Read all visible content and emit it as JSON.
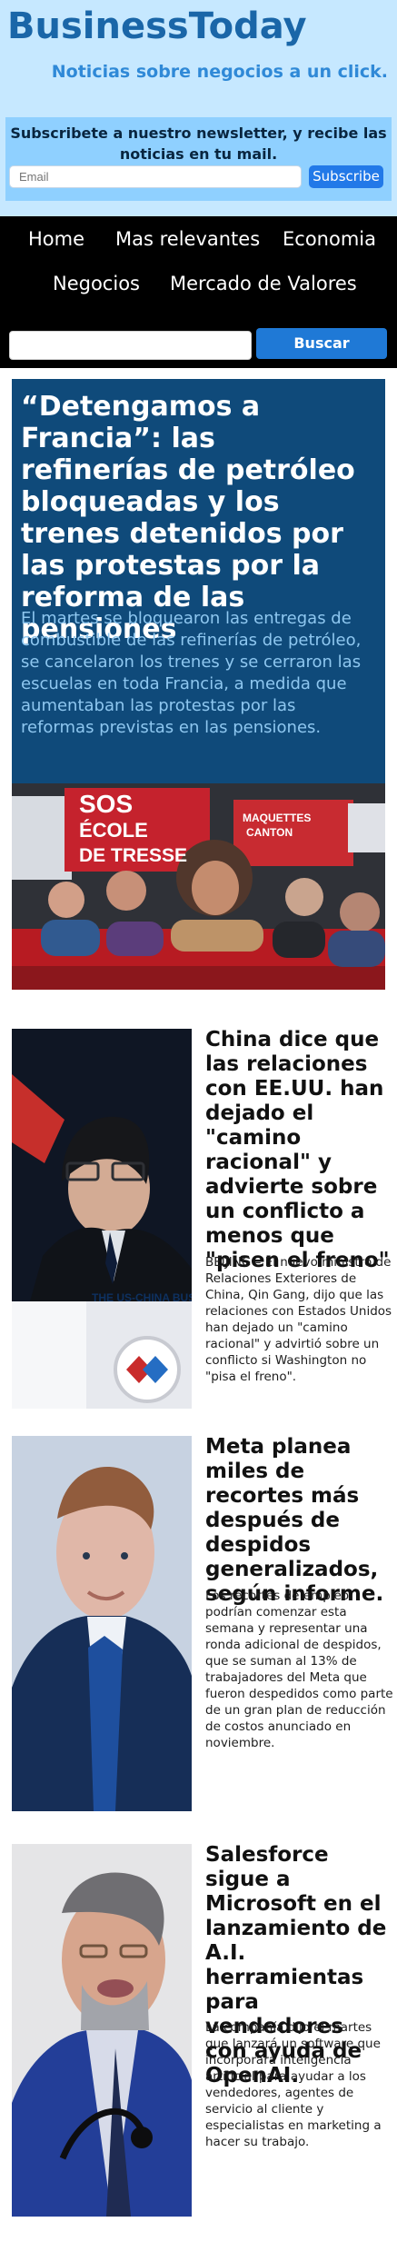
{
  "header": {
    "brand": "BusinessToday",
    "tagline": "Noticias sobre negocios a un click."
  },
  "newsletter": {
    "text": "Subscribete a nuestro newsletter, y recibe las noticias en tu mail.",
    "email_placeholder": "Email",
    "submit_label": "Subscribe"
  },
  "nav": {
    "items": [
      "Home",
      "Mas relevantes",
      "Economia",
      "Negocios",
      "Mercado de Valores"
    ]
  },
  "search": {
    "button_label": "Buscar"
  },
  "feature": {
    "title": "“Detengamos a Francia”: las refinerías de petróleo bloqueadas y los trenes detenidos por las protestas por la reforma de las pensiones",
    "summary": "El martes se bloquearon las entregas de combustible de las refinerías de petróleo, se cancelaron los trenes y se cerraron las escuelas en toda Francia, a medida que aumentaban las protestas por las reformas previstas en las pensiones.",
    "image_text": [
      "SOS",
      "ÉCOLE",
      "DE TRESSE",
      "MAQUETTES",
      "CANTON"
    ]
  },
  "articles": [
    {
      "title": "China dice que las relaciones con EE.UU. han dejado el \"camino racional\" y advierte sobre un conflicto a menos que \"pisen el freno\"",
      "summary": "BEIJING – El nuevo ministro de Relaciones Exteriores de China, Qin Gang, dijo que las relaciones con Estados Unidos han dejado un \"camino racional\" y advirtió sobre un conflicto si Washington no \"pisa el freno\".",
      "image_text": "THE US-CHINA BUSIN"
    },
    {
      "title": "Meta planea miles de recortes más después de despidos generalizados, según informe.",
      "summary": "Los recortes de empleo podrían comenzar esta semana y representar una ronda adicional de despidos, que se suman al 13% de trabajadores del Meta que fueron despedidos como parte de un gran plan de reducción de costos anunciado en noviembre."
    },
    {
      "title": "Salesforce sigue a Microsoft en el lanzamiento de A.I. herramientas para vendedores con ayuda de OpenAI.",
      "summary": "La compañía dijo el martes que lanzará un software que incorporará inteligencia artificial para ayudar a los vendedores, agentes de servicio al cliente y especialistas en marketing a hacer su trabajo."
    }
  ],
  "colors": {
    "header_bg": "#c6e8ff",
    "newsletter_bg": "#8fd0ff",
    "brand": "#1a66a8",
    "nav_bg": "#000000",
    "feature_bg": "#0f4a7a",
    "button": "#1f79d6"
  }
}
